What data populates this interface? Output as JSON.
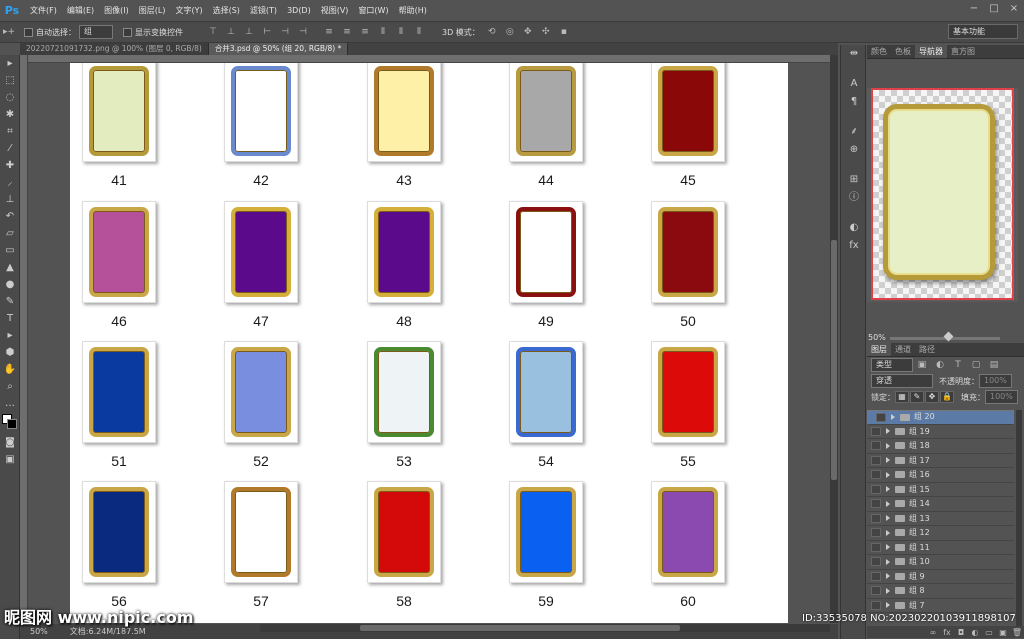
{
  "menubar": {
    "logo": "Ps",
    "items": [
      "文件(F)",
      "编辑(E)",
      "图像(I)",
      "图层(L)",
      "文字(Y)",
      "选择(S)",
      "滤镜(T)",
      "3D(D)",
      "视图(V)",
      "窗口(W)",
      "帮助(H)"
    ]
  },
  "window_controls": [
    "−",
    "□",
    "×"
  ],
  "options": {
    "auto_select_label": "自动选择：",
    "auto_select_value": "组",
    "show_transform_label": "显示变换控件",
    "mode_3d_label": "3D 模式：",
    "workspace": "基本功能"
  },
  "tabs": [
    "20220721091732.png @ 100% (图层 0, RGB/8)",
    "合并3.psd @ 50% (组 20, RGB/8) *"
  ],
  "canvas": {
    "items": [
      {
        "num": "41",
        "fill": "#e3ecbf",
        "border": "#b59a3a"
      },
      {
        "num": "42",
        "fill": "#ffffff",
        "border": "#6a8ad0"
      },
      {
        "num": "43",
        "fill": "#fff0a8",
        "border": "#b07a2a"
      },
      {
        "num": "44",
        "fill": "#a8a8a8",
        "border": "#b89a40"
      },
      {
        "num": "45",
        "fill": "#8a0808",
        "border": "#c9a646"
      },
      {
        "num": "46",
        "fill": "#b5509a",
        "border": "#c9a646"
      },
      {
        "num": "47",
        "fill": "#5a0a8a",
        "border": "#d4b03a"
      },
      {
        "num": "48",
        "fill": "#5a0a8a",
        "border": "#d4b03a"
      },
      {
        "num": "49",
        "fill": "#ffffff",
        "border": "#8a1010"
      },
      {
        "num": "50",
        "fill": "#8a0a10",
        "border": "#c9a646"
      },
      {
        "num": "51",
        "fill": "#0a3aa0",
        "border": "#c9a646"
      },
      {
        "num": "52",
        "fill": "#7a8ee0",
        "border": "#c9a646"
      },
      {
        "num": "53",
        "fill": "#eef4f6",
        "border": "#4a8a30"
      },
      {
        "num": "54",
        "fill": "#9ac0e0",
        "border": "#3a6ad0"
      },
      {
        "num": "55",
        "fill": "#dd0a0a",
        "border": "#c9a646"
      },
      {
        "num": "56",
        "fill": "#0a2a80",
        "border": "#c9a646"
      },
      {
        "num": "57",
        "fill": "#ffffff",
        "border": "#b07a2a"
      },
      {
        "num": "58",
        "fill": "#d40a0a",
        "border": "#c9a646"
      },
      {
        "num": "59",
        "fill": "#0a60f0",
        "border": "#c9a646"
      },
      {
        "num": "60",
        "fill": "#8a4ab0",
        "border": "#c9a646"
      }
    ]
  },
  "status": {
    "zoom": "50%",
    "doc": "文档:6.24M/187.5M"
  },
  "panel_tabs": [
    "颜色",
    "色板",
    "导航器",
    "直方图"
  ],
  "navigator_zoom": "50%",
  "layers_tabs": [
    "图层",
    "通道",
    "路径"
  ],
  "layers_filter": "类型",
  "blend_mode": "穿透",
  "opacity_label": "不透明度：",
  "opacity_value": "100%",
  "lock_label": "锁定：",
  "fill_label": "填充：",
  "fill_value": "100%",
  "layers": [
    "组 20",
    "组 19",
    "组 18",
    "组 17",
    "组 16",
    "组 15",
    "组 14",
    "组 13",
    "组 12",
    "组 11",
    "组 10",
    "组 9",
    "组 8",
    "组 7"
  ],
  "layer_bottom_icons": [
    "∞",
    "fx",
    "◘",
    "◐",
    "▭",
    "▣",
    "🗑"
  ],
  "watermark": {
    "left": "昵图网 www.nipic.com",
    "right": "ID:33535078 NO:20230220103911898107"
  }
}
